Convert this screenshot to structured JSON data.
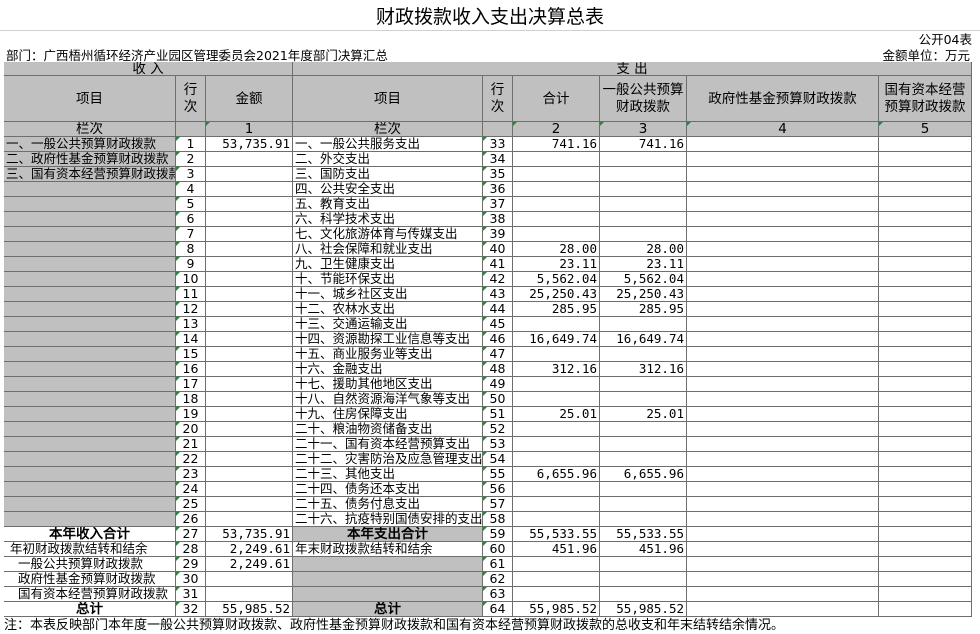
{
  "title": "财政拨款收入支出决算总表",
  "form_code": "公开04表",
  "department": "部门：广西梧州循环经济产业园区管理委员会2021年度部门决算汇总",
  "unit": "金额单位：万元",
  "headers": {
    "income_group": "收        入",
    "expense_group": "支        出",
    "item": "项目",
    "line_no": "行次",
    "amount": "金额",
    "item2": "项目",
    "line_no2": "行次",
    "total": "合计",
    "general_budget": "一般公共预算财政拨款",
    "gov_fund": "政府性基金预算财政拨款",
    "state_capital": "国有资本经营预算财政拨款",
    "col_label": "栏次",
    "col_label2": "栏次",
    "col1": "1",
    "col2": "2",
    "col3": "3",
    "col4": "4",
    "col5": "5"
  },
  "rows": [
    {
      "inc": "一、一般公共预算财政拨款",
      "ln": "1",
      "amt": "53,735.91",
      "exp": "一、一般公共服务支出",
      "ln2": "33",
      "tot": "741.16",
      "gen": "741.16"
    },
    {
      "inc": "二、政府性基金预算财政拨款",
      "ln": "2",
      "amt": "",
      "exp": "二、外交支出",
      "ln2": "34",
      "tot": "",
      "gen": ""
    },
    {
      "inc": "三、国有资本经营预算财政拨款",
      "ln": "3",
      "amt": "",
      "exp": "三、国防支出",
      "ln2": "35",
      "tot": "",
      "gen": ""
    },
    {
      "inc": "",
      "ln": "4",
      "amt": "",
      "exp": "四、公共安全支出",
      "ln2": "36",
      "tot": "",
      "gen": ""
    },
    {
      "inc": "",
      "ln": "5",
      "amt": "",
      "exp": "五、教育支出",
      "ln2": "37",
      "tot": "",
      "gen": ""
    },
    {
      "inc": "",
      "ln": "6",
      "amt": "",
      "exp": "六、科学技术支出",
      "ln2": "38",
      "tot": "",
      "gen": ""
    },
    {
      "inc": "",
      "ln": "7",
      "amt": "",
      "exp": "七、文化旅游体育与传媒支出",
      "ln2": "39",
      "tot": "",
      "gen": ""
    },
    {
      "inc": "",
      "ln": "8",
      "amt": "",
      "exp": "八、社会保障和就业支出",
      "ln2": "40",
      "tot": "28.00",
      "gen": "28.00"
    },
    {
      "inc": "",
      "ln": "9",
      "amt": "",
      "exp": "九、卫生健康支出",
      "ln2": "41",
      "tot": "23.11",
      "gen": "23.11"
    },
    {
      "inc": "",
      "ln": "10",
      "amt": "",
      "exp": "十、节能环保支出",
      "ln2": "42",
      "tot": "5,562.04",
      "gen": "5,562.04"
    },
    {
      "inc": "",
      "ln": "11",
      "amt": "",
      "exp": "十一、城乡社区支出",
      "ln2": "43",
      "tot": "25,250.43",
      "gen": "25,250.43"
    },
    {
      "inc": "",
      "ln": "12",
      "amt": "",
      "exp": "十二、农林水支出",
      "ln2": "44",
      "tot": "285.95",
      "gen": "285.95"
    },
    {
      "inc": "",
      "ln": "13",
      "amt": "",
      "exp": "十三、交通运输支出",
      "ln2": "45",
      "tot": "",
      "gen": ""
    },
    {
      "inc": "",
      "ln": "14",
      "amt": "",
      "exp": "十四、资源勘探工业信息等支出",
      "ln2": "46",
      "tot": "16,649.74",
      "gen": "16,649.74"
    },
    {
      "inc": "",
      "ln": "15",
      "amt": "",
      "exp": "十五、商业服务业等支出",
      "ln2": "47",
      "tot": "",
      "gen": ""
    },
    {
      "inc": "",
      "ln": "16",
      "amt": "",
      "exp": "十六、金融支出",
      "ln2": "48",
      "tot": "312.16",
      "gen": "312.16"
    },
    {
      "inc": "",
      "ln": "17",
      "amt": "",
      "exp": "十七、援助其他地区支出",
      "ln2": "49",
      "tot": "",
      "gen": ""
    },
    {
      "inc": "",
      "ln": "18",
      "amt": "",
      "exp": "十八、自然资源海洋气象等支出",
      "ln2": "50",
      "tot": "",
      "gen": ""
    },
    {
      "inc": "",
      "ln": "19",
      "amt": "",
      "exp": "十九、住房保障支出",
      "ln2": "51",
      "tot": "25.01",
      "gen": "25.01"
    },
    {
      "inc": "",
      "ln": "20",
      "amt": "",
      "exp": "二十、粮油物资储备支出",
      "ln2": "52",
      "tot": "",
      "gen": ""
    },
    {
      "inc": "",
      "ln": "21",
      "amt": "",
      "exp": "二十一、国有资本经营预算支出",
      "ln2": "53",
      "tot": "",
      "gen": ""
    },
    {
      "inc": "",
      "ln": "22",
      "amt": "",
      "exp": "二十二、灾害防治及应急管理支出",
      "ln2": "54",
      "tot": "",
      "gen": ""
    },
    {
      "inc": "",
      "ln": "23",
      "amt": "",
      "exp": "二十三、其他支出",
      "ln2": "55",
      "tot": "6,655.96",
      "gen": "6,655.96"
    },
    {
      "inc": "",
      "ln": "24",
      "amt": "",
      "exp": "二十四、债务还本支出",
      "ln2": "56",
      "tot": "",
      "gen": ""
    },
    {
      "inc": "",
      "ln": "25",
      "amt": "",
      "exp": "二十五、债务付息支出",
      "ln2": "57",
      "tot": "",
      "gen": ""
    },
    {
      "inc": "",
      "ln": "26",
      "amt": "",
      "exp": "二十六、抗疫特别国债安排的支出",
      "ln2": "58",
      "tot": "",
      "gen": ""
    },
    {
      "inc": "本年收入合计",
      "ln": "27",
      "amt": "53,735.91",
      "exp": "本年支出合计",
      "ln2": "59",
      "tot": "55,533.55",
      "gen": "55,533.55"
    },
    {
      "inc": "年初财政拨款结转和结余",
      "ln": "28",
      "amt": "2,249.61",
      "exp": "年末财政拨款结转和结余",
      "ln2": "60",
      "tot": "451.96",
      "gen": "451.96"
    },
    {
      "inc": "一般公共预算财政拨款",
      "ln": "29",
      "amt": "2,249.61",
      "exp": "",
      "ln2": "61",
      "tot": "",
      "gen": ""
    },
    {
      "inc": "政府性基金预算财政拨款",
      "ln": "30",
      "amt": "",
      "exp": "",
      "ln2": "62",
      "tot": "",
      "gen": ""
    },
    {
      "inc": "国有资本经营预算财政拨款",
      "ln": "31",
      "amt": "",
      "exp": "",
      "ln2": "63",
      "tot": "",
      "gen": ""
    },
    {
      "inc": "总计",
      "ln": "32",
      "amt": "55,985.52",
      "exp": "总计",
      "ln2": "64",
      "tot": "55,985.52",
      "gen": "55,985.52"
    }
  ],
  "note": "注：本表反映部门本年度一般公共预算财政拨款、政府性基金预算财政拨款和国有资本经营预算财政拨款的总收支和年末结转结余情况。"
}
